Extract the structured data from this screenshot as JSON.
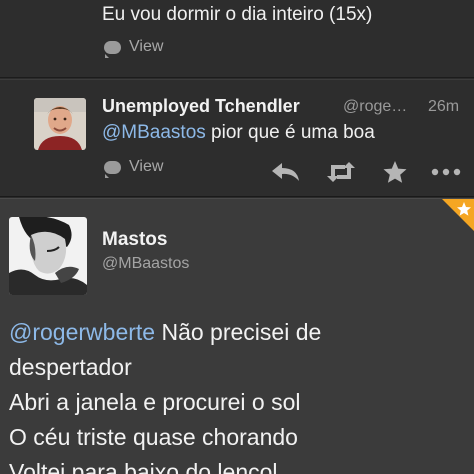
{
  "top_tweet": {
    "text": "Eu vou dormir o dia inteiro (15x)",
    "view_label": "View"
  },
  "reply_tweet": {
    "name": "Unemployed Tchendler",
    "handle": "@roge…",
    "time": "26m",
    "mention": "@MBaastos",
    "text": " pior que é uma boa",
    "view_label": "View",
    "actions": [
      "reply-icon",
      "retweet-icon",
      "favorite-icon",
      "more-icon"
    ]
  },
  "main_tweet": {
    "name": "Mastos",
    "handle": "@MBaastos",
    "mention": "@rogerwberte",
    "lines": [
      " Não precisei de",
      "despertador",
      "Abri a janela e procurei o sol",
      "O céu triste quase chorando",
      "Voltei para baixo do lençol"
    ]
  },
  "colors": {
    "background": "#2d2d2d",
    "focused_background": "#3b3b3b",
    "mention": "#8db9e8",
    "favorite_corner": "#f5a623"
  }
}
